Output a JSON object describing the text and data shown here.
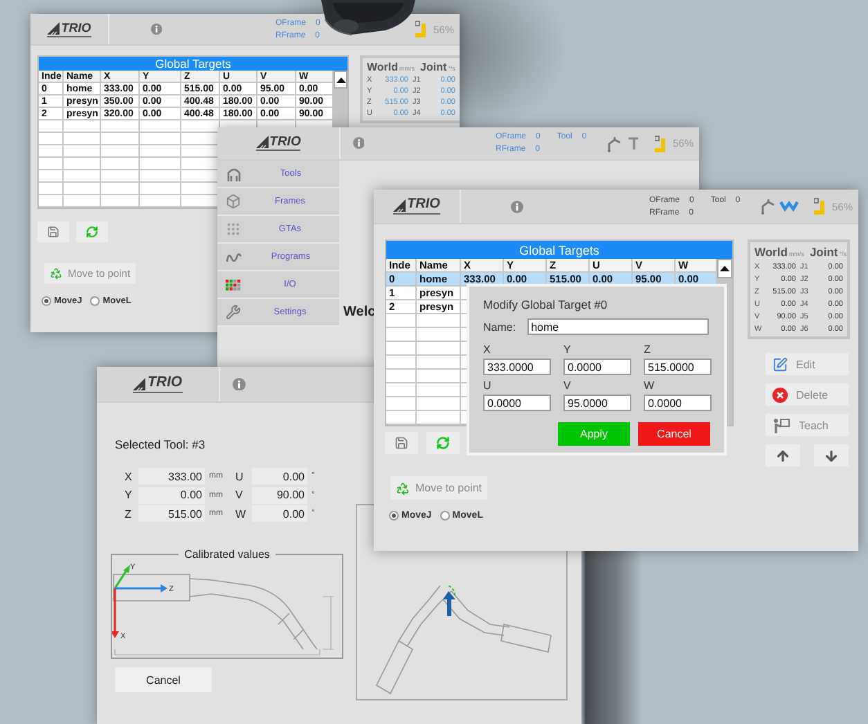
{
  "targets_window": {
    "header": {
      "kind": "basic",
      "logo": "TRIO",
      "status_rows": [
        [
          {
            "label": "OFrame",
            "value": "0"
          }
        ],
        [
          {
            "label": "RFrame",
            "value": "0"
          }
        ]
      ],
      "battery": "56%"
    },
    "table": {
      "title": "Global Targets",
      "columns": [
        "Inde",
        "Name",
        "X",
        "Y",
        "Z",
        "U",
        "V",
        "W"
      ],
      "rows": [
        {
          "cells": [
            "0",
            "home",
            "333.00",
            "0.00",
            "515.00",
            "0.00",
            "95.00",
            "0.00"
          ],
          "selected": false
        },
        {
          "cells": [
            "1",
            "presyn",
            "350.00",
            "0.00",
            "400.48",
            "180.00",
            "0.00",
            "90.00"
          ],
          "selected": false
        },
        {
          "cells": [
            "2",
            "presyn",
            "320.00",
            "0.00",
            "400.48",
            "180.00",
            "0.00",
            "90.00"
          ],
          "selected": false
        }
      ]
    },
    "world_panel": {
      "world": "World",
      "world_unit": "mm/s",
      "joint": "Joint",
      "joint_unit": "°/s",
      "rows": [
        {
          "axis": "X",
          "value": "333.00",
          "joint": "J1",
          "joint_value": "0.00"
        },
        {
          "axis": "Y",
          "value": "0.00",
          "joint": "J2",
          "joint_value": "0.00"
        },
        {
          "axis": "Z",
          "value": "515.00",
          "joint": "J3",
          "joint_value": "0.00"
        },
        {
          "axis": "U",
          "value": "0.00",
          "joint": "J4",
          "joint_value": "0.00"
        }
      ]
    },
    "move_button": "Move to point",
    "motions": [
      {
        "label": "MoveJ",
        "selected": true
      },
      {
        "label": "MoveL",
        "selected": false
      }
    ]
  },
  "menu_window": {
    "header": {
      "kind": "menu",
      "logo": "TRIO",
      "status_rows": [
        [
          {
            "label": "OFrame",
            "value": "0"
          },
          {
            "label": "Tool",
            "value": "0"
          }
        ],
        [
          {
            "label": "RFrame",
            "value": "0"
          }
        ]
      ],
      "battery": "56%"
    },
    "menu": [
      {
        "kind": "tools",
        "label": "Tools"
      },
      {
        "kind": "frames",
        "label": "Frames"
      },
      {
        "kind": "gtas",
        "label": "GTAs"
      },
      {
        "kind": "programs",
        "label": "Programs"
      },
      {
        "kind": "io",
        "label": "I/O"
      },
      {
        "kind": "settings",
        "label": "Settings"
      }
    ],
    "welcome": "Welc"
  },
  "tool_window": {
    "header": {
      "logo": "TRIO"
    },
    "selected_tool": "Selected Tool: #3",
    "values": [
      {
        "axis": "X",
        "value": "333.00",
        "unit": "mm",
        "rot_axis": "U",
        "rot_value": "0.00",
        "rot_unit": "°"
      },
      {
        "axis": "Y",
        "value": "0.00",
        "unit": "mm",
        "rot_axis": "V",
        "rot_value": "90.00",
        "rot_unit": "°"
      },
      {
        "axis": "Z",
        "value": "515.00",
        "unit": "mm",
        "rot_axis": "W",
        "rot_value": "0.00",
        "rot_unit": "°"
      }
    ],
    "calibrated_title": "Calibrated values",
    "axis_labels": [
      "Y",
      "Z",
      "X"
    ],
    "cancel": "Cancel"
  },
  "edit_window": {
    "header": {
      "kind": "edit",
      "logo": "TRIO",
      "status_rows": [
        [
          {
            "label": "OFrame",
            "value": "0"
          },
          {
            "label": "Tool",
            "value": "0"
          }
        ],
        [
          {
            "label": "RFrame",
            "value": "0"
          }
        ]
      ],
      "battery": "56%"
    },
    "table": {
      "title": "Global Targets",
      "columns": [
        "Inde",
        "Name",
        "X",
        "Y",
        "Z",
        "U",
        "V",
        "W"
      ],
      "rows": [
        {
          "cells": [
            "0",
            "home",
            "333.00",
            "0.00",
            "515.00",
            "0.00",
            "95.00",
            "0.00"
          ],
          "selected": true
        },
        {
          "cells": [
            "1",
            "presyn"
          ],
          "selected": false
        },
        {
          "cells": [
            "2",
            "presyn"
          ],
          "selected": false
        }
      ]
    },
    "world_panel": {
      "world": "World",
      "world_unit": "mm/s",
      "joint": "Joint",
      "joint_unit": "°/s",
      "rows": [
        {
          "axis": "X",
          "value": "333.00",
          "joint": "J1",
          "joint_value": "0.00"
        },
        {
          "axis": "Y",
          "value": "0.00",
          "joint": "J2",
          "joint_value": "0.00"
        },
        {
          "axis": "Z",
          "value": "515.00",
          "joint": "J3",
          "joint_value": "0.00"
        },
        {
          "axis": "U",
          "value": "0.00",
          "joint": "J4",
          "joint_value": "0.00"
        },
        {
          "axis": "V",
          "value": "90.00",
          "joint": "J5",
          "joint_value": "0.00"
        },
        {
          "axis": "W",
          "value": "0.00",
          "joint": "J6",
          "joint_value": "0.00"
        }
      ]
    },
    "side_buttons": [
      {
        "kind": "edit",
        "label": "Edit"
      },
      {
        "kind": "delete",
        "label": "Delete"
      },
      {
        "kind": "teach",
        "label": "Teach"
      }
    ],
    "move_button": "Move to point",
    "motions": [
      {
        "label": "MoveJ",
        "selected": true
      },
      {
        "label": "MoveL",
        "selected": false
      }
    ],
    "dialog": {
      "title": "Modify Global Target #0",
      "name_label": "Name:",
      "name": "home",
      "fields": [
        {
          "label": "X",
          "value": "333.0000"
        },
        {
          "label": "Y",
          "value": "0.0000"
        },
        {
          "label": "Z",
          "value": "515.0000"
        },
        {
          "label": "U",
          "value": "0.0000"
        },
        {
          "label": "V",
          "value": "95.0000"
        },
        {
          "label": "W",
          "value": "0.0000"
        }
      ],
      "apply": "Apply",
      "cancel": "Cancel"
    }
  }
}
